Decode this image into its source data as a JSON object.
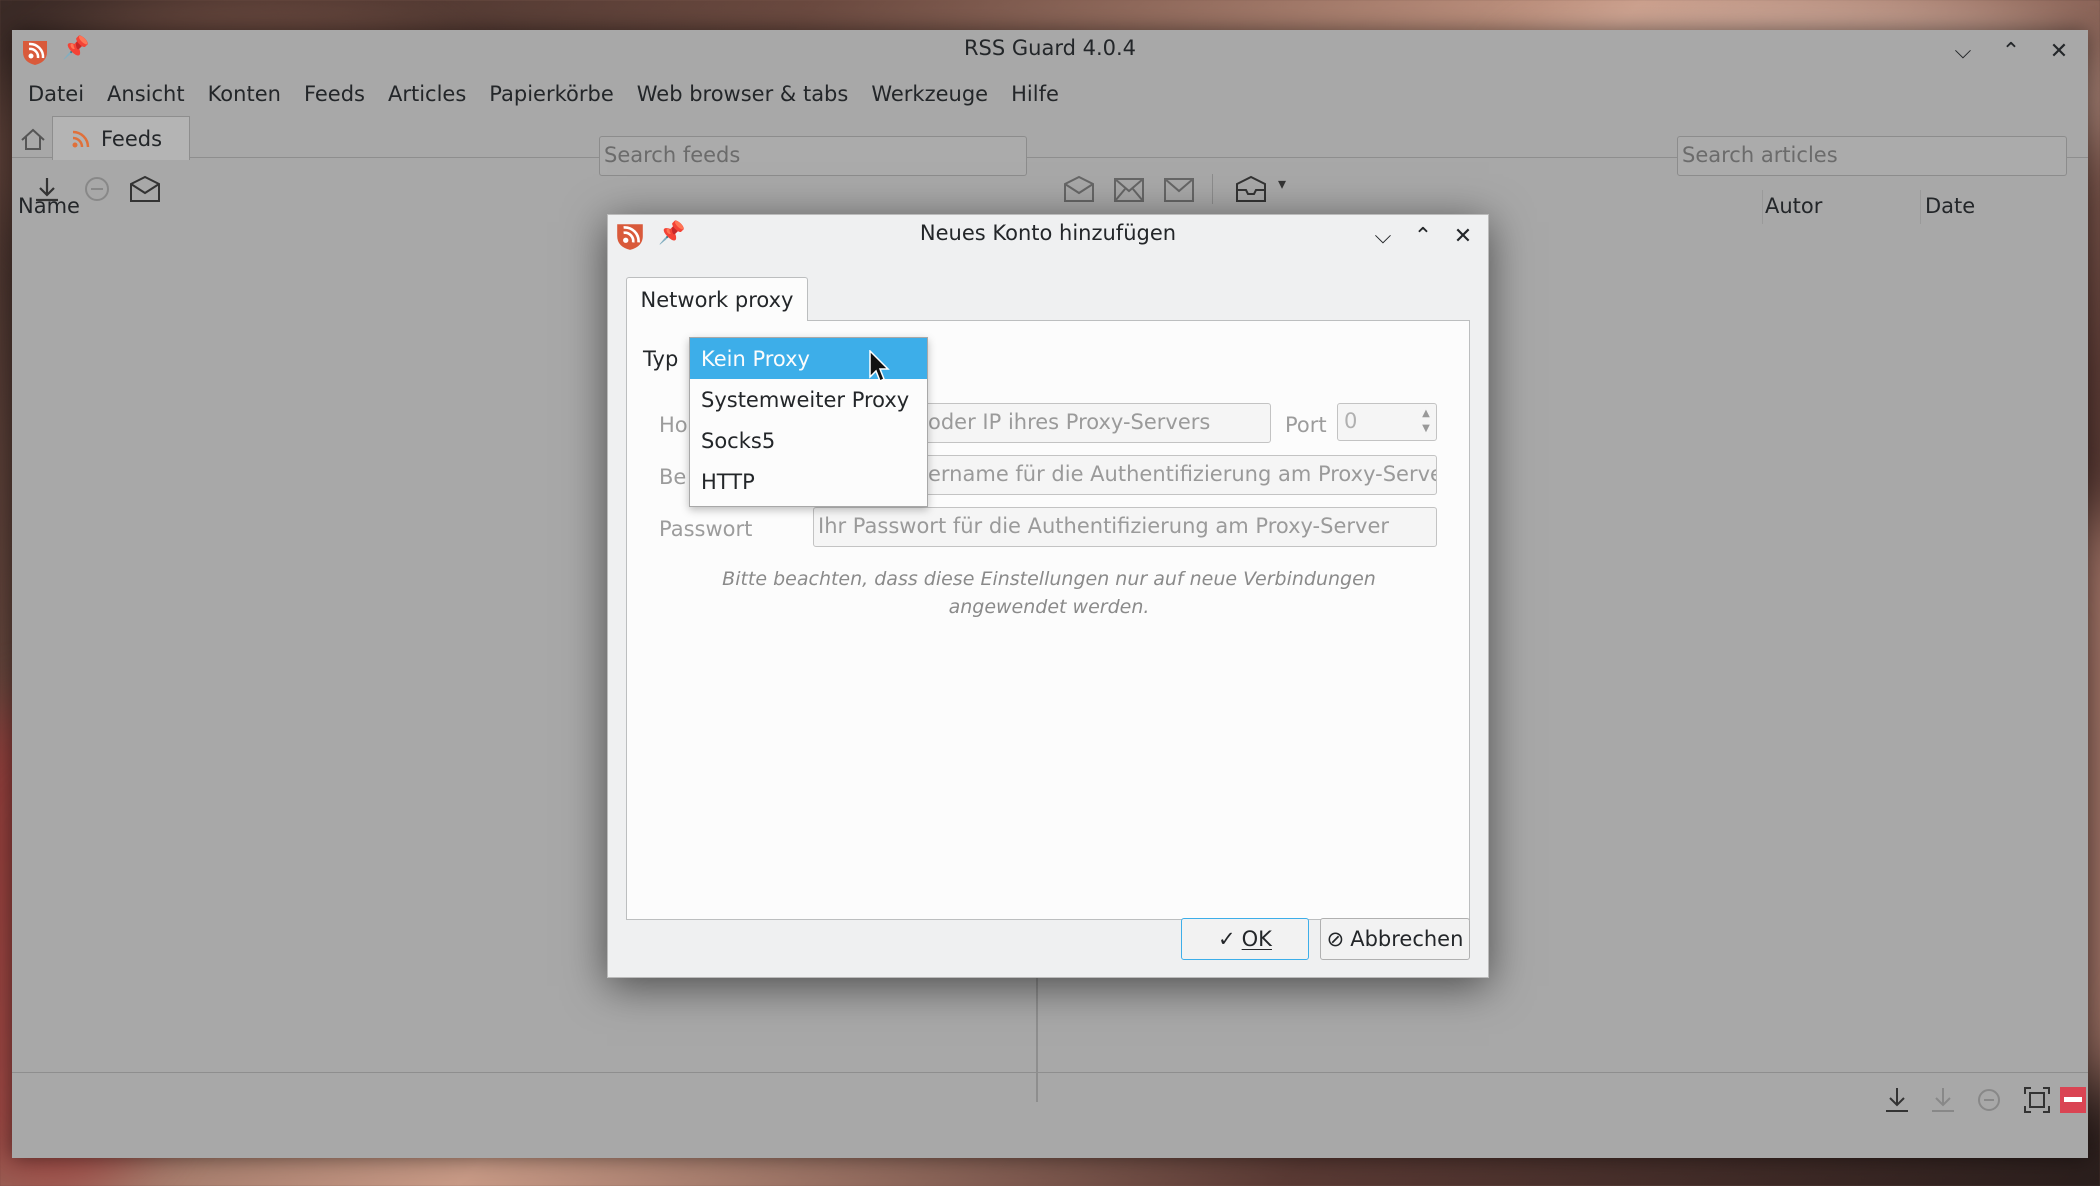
{
  "main_window": {
    "title": "RSS Guard 4.0.4",
    "menu": [
      "Datei",
      "Ansicht",
      "Konten",
      "Feeds",
      "Articles",
      "Papierkörbe",
      "Web browser & tabs",
      "Werkzeuge",
      "Hilfe"
    ],
    "tab_label": "Feeds",
    "search_feeds_placeholder": "Search feeds",
    "search_articles_placeholder": "Search articles",
    "columns": {
      "name": "Name",
      "author": "Autor",
      "date": "Date"
    }
  },
  "dialog": {
    "title": "Neues Konto hinzufügen",
    "tab_label": "Network proxy",
    "type_label": "Typ",
    "host_label": "Ho",
    "host_placeholder": "oder IP ihres Proxy-Servers",
    "port_label": "Port",
    "port_value": "0",
    "user_label": "Be",
    "user_placeholder": "ername für die Authentifizierung am Proxy-Server",
    "password_label": "Passwort",
    "password_placeholder": "Ihr Passwort für die Authentifizierung am Proxy-Server",
    "note": "Bitte beachten, dass diese Einstellungen nur auf neue Verbindungen angewendet werden.",
    "ok_label": "OK",
    "cancel_label": "Abbrechen",
    "proxy_options": [
      "Kein Proxy",
      "Systemweiter Proxy",
      "Socks5",
      "HTTP"
    ],
    "selected_option": "Kein Proxy"
  },
  "colors": {
    "accent": "#3daee9",
    "brand": "#da4453"
  }
}
